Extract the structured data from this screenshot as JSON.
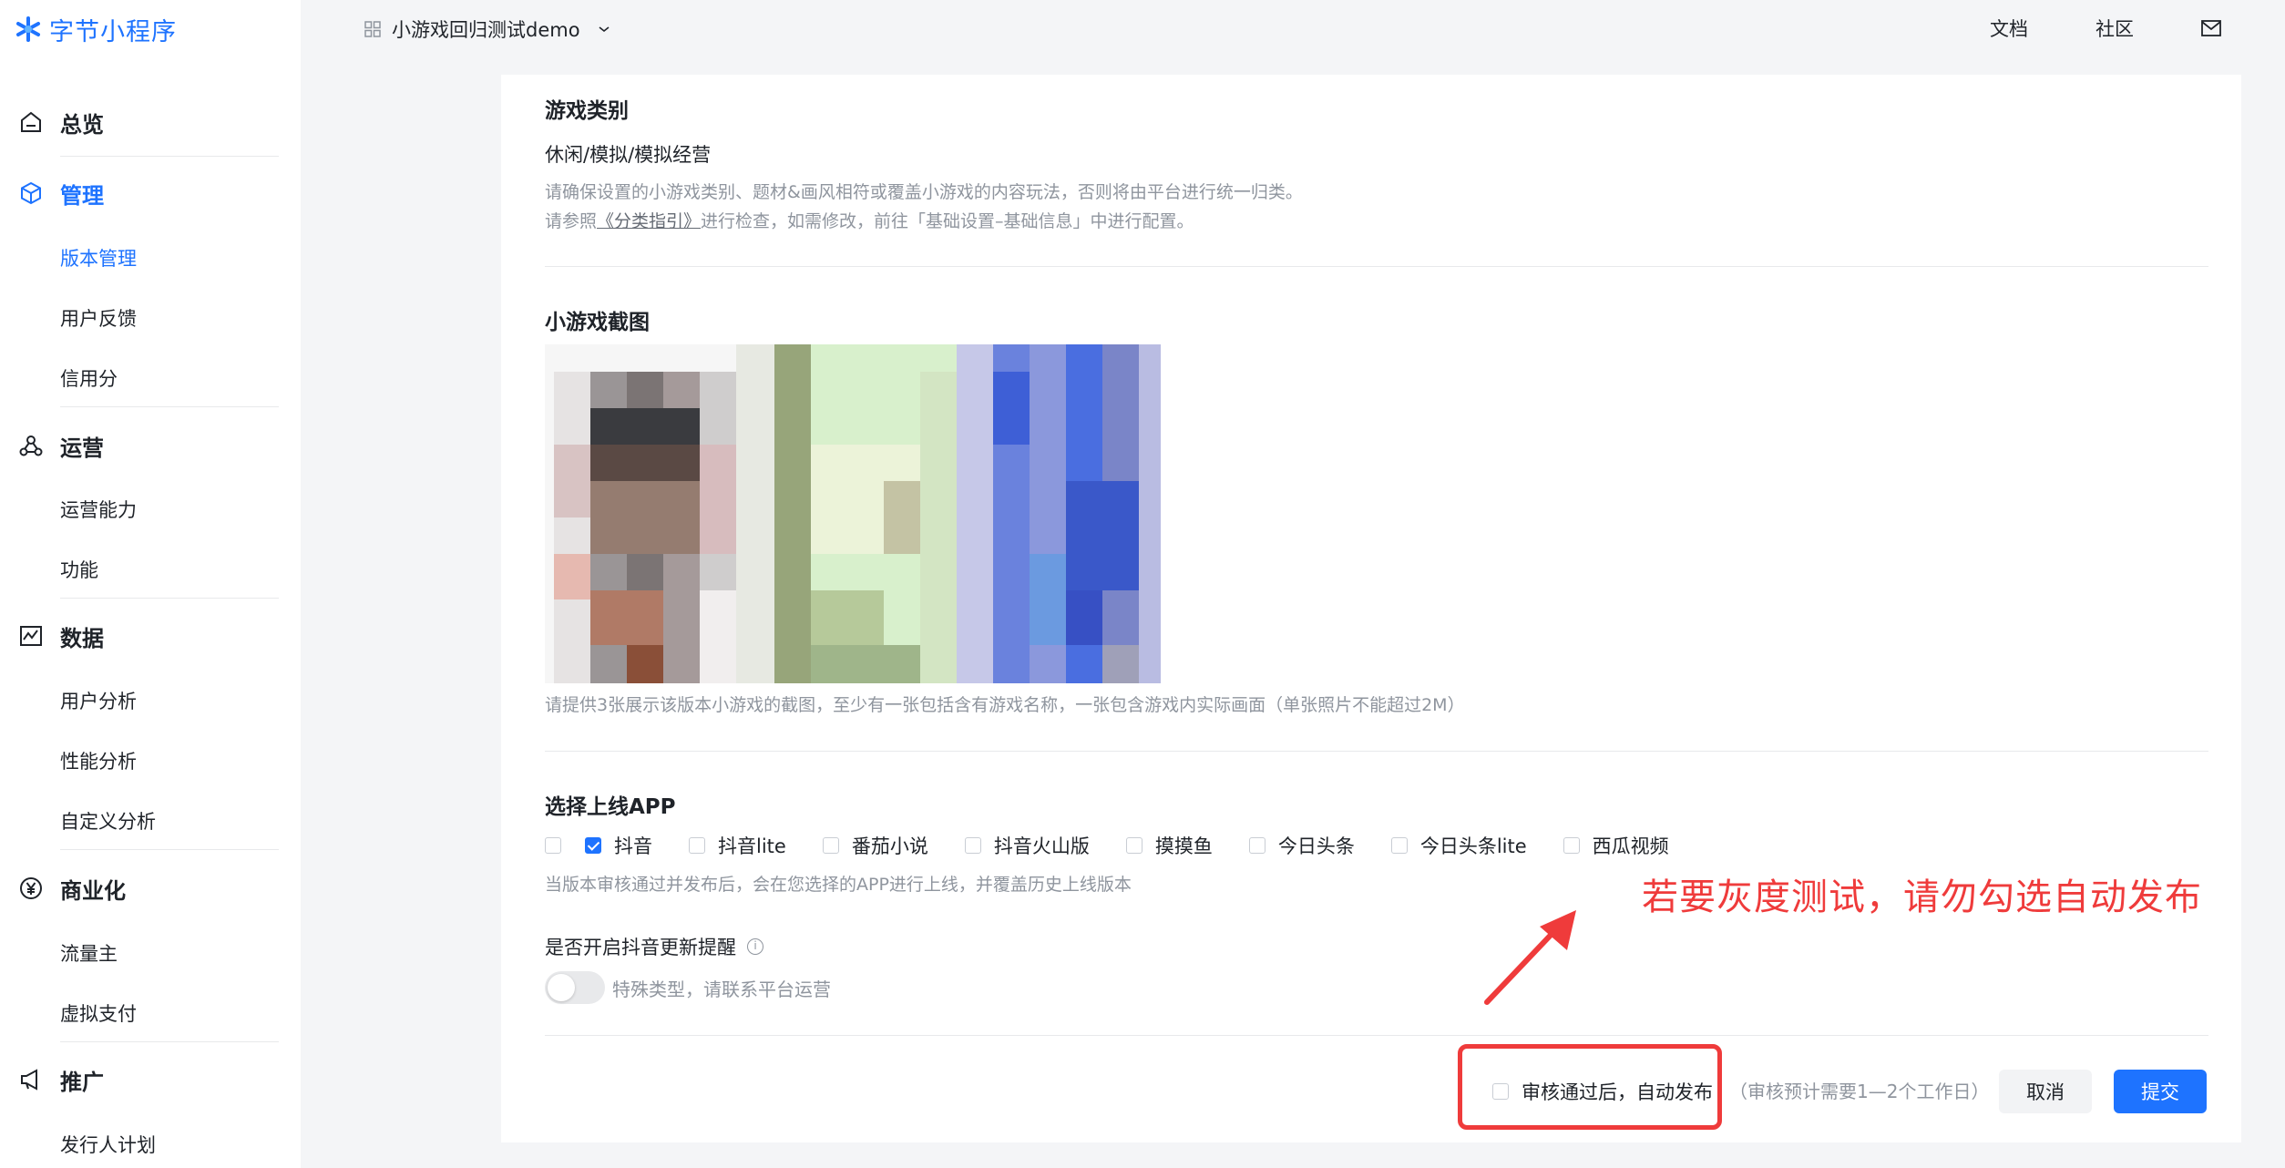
{
  "brand": {
    "name": "字节小程序",
    "color": "#1e73ff"
  },
  "topbar": {
    "project_name": "小游戏回归测试demo",
    "links": {
      "docs": "文档",
      "community": "社区"
    },
    "icons": [
      "grid-icon",
      "chevron-down-icon",
      "mail-icon"
    ]
  },
  "sidebar": {
    "overview": "总览",
    "manage": {
      "label": "管理",
      "items": [
        "版本管理",
        "用户反馈",
        "信用分"
      ]
    },
    "operate": {
      "label": "运营",
      "items": [
        "运营能力",
        "功能"
      ]
    },
    "data": {
      "label": "数据",
      "items": [
        "用户分析",
        "性能分析",
        "自定义分析"
      ]
    },
    "business": {
      "label": "商业化",
      "items": [
        "流量主",
        "虚拟支付"
      ]
    },
    "promote": {
      "label": "推广",
      "items": [
        "发行人计划"
      ]
    }
  },
  "category": {
    "title": "游戏类别",
    "value": "休闲/模拟/模拟经营",
    "hint_line1": "请确保设置的小游戏类别、题材&画风相符或覆盖小游戏的内容玩法，否则将由平台进行统一归类。",
    "hint_line2_pre": "请参照",
    "hint_link": "《分类指引》",
    "hint_line2_post": "进行检查，如需修改，前往「基础设置–基础信息」中进行配置。"
  },
  "screenshots": {
    "title": "小游戏截图",
    "hint": "请提供3张展示该版本小游戏的截图，至少有一张包括含有游戏名称，一张包含游戏内实际画面（单张照片不能超过2M）"
  },
  "apps": {
    "title": "选择上线APP",
    "options": [
      {
        "label": "",
        "checked": false
      },
      {
        "label": "抖音",
        "checked": true
      },
      {
        "label": "抖音lite",
        "checked": false
      },
      {
        "label": "番茄小说",
        "checked": false
      },
      {
        "label": "抖音火山版",
        "checked": false
      },
      {
        "label": "摸摸鱼",
        "checked": false
      },
      {
        "label": "今日头条",
        "checked": false
      },
      {
        "label": "今日头条lite",
        "checked": false
      },
      {
        "label": "西瓜视频",
        "checked": false
      }
    ],
    "hint": "当版本审核通过并发布后，会在您选择的APP进行上线，并覆盖历史上线版本"
  },
  "reminder": {
    "title": "是否开启抖音更新提醒",
    "toggle_on": false,
    "toggle_text": "特殊类型，请联系平台运营"
  },
  "annotation": {
    "text": "若要灰度测试，请勿勾选自动发布",
    "color": "#ef3b3b"
  },
  "footer": {
    "auto_publish_label": "审核通过后，自动发布",
    "auto_publish_checked": false,
    "estimate": "（审核预计需要1—2个工作日）",
    "cancel": "取消",
    "submit": "提交"
  }
}
